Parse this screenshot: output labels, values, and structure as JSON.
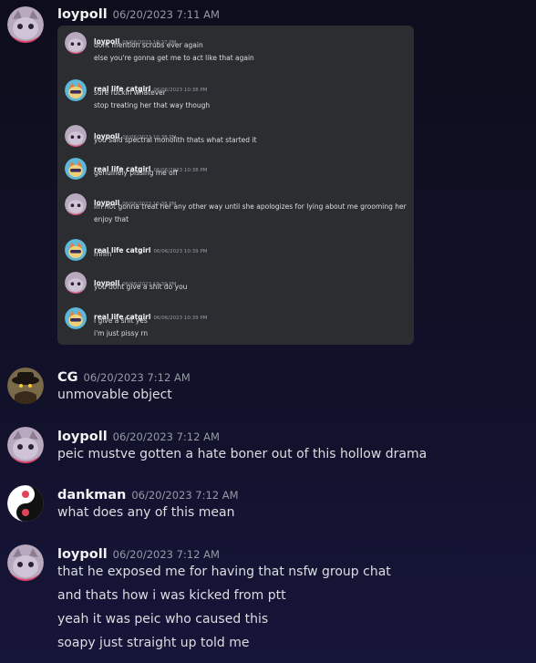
{
  "messages": [
    {
      "author": "loypoll",
      "timestamp": "06/20/2023 7:11 AM",
      "avatar_icon": "cat-avatar-icon"
    },
    {
      "author": "CG",
      "timestamp": "06/20/2023 7:12 AM",
      "avatar_icon": "hat-avatar-icon",
      "lines": [
        "unmovable object"
      ]
    },
    {
      "author": "loypoll",
      "timestamp": "06/20/2023 7:12 AM",
      "avatar_icon": "cat-avatar-icon",
      "lines": [
        "peic mustve gotten a hate boner out of this hollow drama"
      ]
    },
    {
      "author": "dankman",
      "timestamp": "06/20/2023 7:12 AM",
      "avatar_icon": "yinyang-avatar-icon",
      "lines": [
        "what does any of this mean"
      ]
    },
    {
      "author": "loypoll",
      "timestamp": "06/20/2023 7:12 AM",
      "avatar_icon": "cat-avatar-icon",
      "lines": [
        "that he exposed me for having that nsfw group chat",
        "and thats how i was kicked from ptt",
        "yeah it was peic who caused this",
        "soapy just straight up told me"
      ]
    }
  ],
  "quoted": [
    {
      "author": "loypoll",
      "timestamp": "06/06/2023 10:37 PM",
      "lines": [
        "dont mention scrubs ever again",
        "else you're gonna get me to act like that again"
      ]
    },
    {
      "author": "real life catgirl",
      "timestamp": "06/06/2023 10:38 PM",
      "lines": [
        "sure fuckin whatever",
        "stop treating her that way though"
      ]
    },
    {
      "author": "loypoll",
      "timestamp": "06/06/2023 10:38 PM",
      "lines": [
        "you said spectral monolith thats what started it"
      ]
    },
    {
      "author": "real life catgirl",
      "timestamp": "06/06/2023 10:38 PM",
      "lines": [
        "genuinely pissing me off"
      ]
    },
    {
      "author": "loypoll",
      "timestamp": "06/06/2023 10:38 PM",
      "lines": [
        "im not gonna treat her any other way until she apologizes for lying about me grooming her",
        "enjoy that"
      ]
    },
    {
      "author": "real life catgirl",
      "timestamp": "06/06/2023 10:39 PM",
      "lines": [
        "mhm"
      ]
    },
    {
      "author": "loypoll",
      "timestamp": "06/06/2023 10:39 PM",
      "lines": [
        "you dont give a shit do you"
      ]
    },
    {
      "author": "real life catgirl",
      "timestamp": "06/06/2023 10:39 PM",
      "lines": [
        "i give a shit yes",
        "i'm just pissy rn"
      ]
    }
  ],
  "colors": {
    "background": "#12112a",
    "embed": "#2b2d31",
    "username": "#f2f3f5",
    "timestamp": "#949ba4"
  }
}
